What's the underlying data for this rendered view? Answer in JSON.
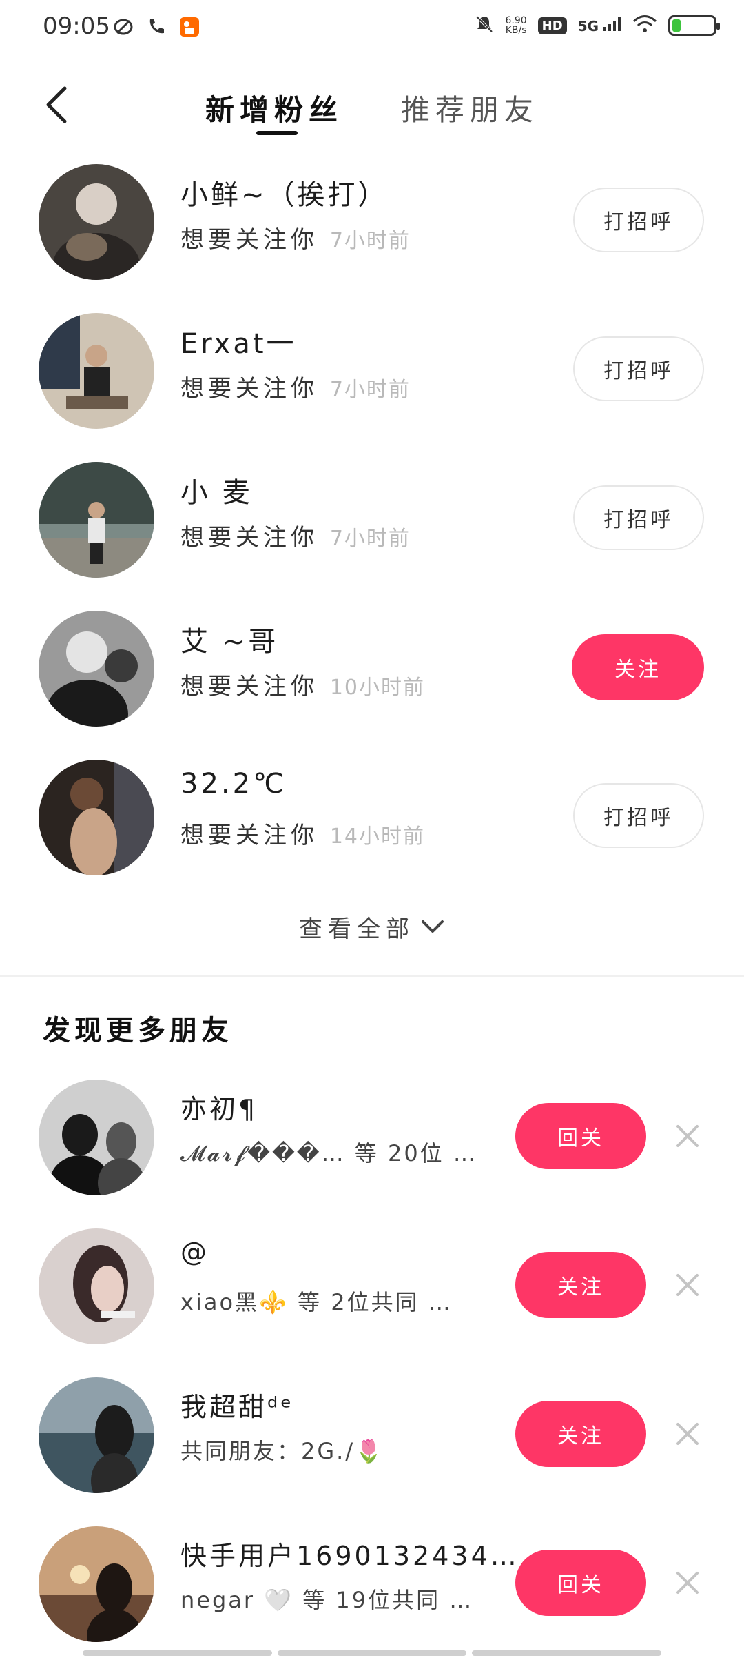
{
  "status_bar": {
    "time": "09:05",
    "net_speed": "6.90",
    "net_unit": "KB/s",
    "hd": "HD",
    "network": "5G",
    "battery_level": 0.12,
    "icons_left": [
      "leaf-icon",
      "call-missed-icon",
      "kuaishou-app-icon"
    ],
    "icons_right": [
      "mute-icon",
      "signal-icon",
      "wifi-icon",
      "battery-icon"
    ]
  },
  "header": {
    "tabs": [
      {
        "label": "新增粉丝",
        "active": true
      },
      {
        "label": "推荐朋友",
        "active": false
      }
    ]
  },
  "followers": [
    {
      "name": "小鲜~（挨打）",
      "action": "想要关注你",
      "time": "7小时前",
      "button": "打招呼",
      "button_style": "outline",
      "avatar": "#3b3b3b"
    },
    {
      "name": "Erxat一",
      "action": "想要关注你",
      "time": "7小时前",
      "button": "打招呼",
      "button_style": "outline",
      "avatar": "#6a6f75"
    },
    {
      "name": "小 麦",
      "action": "想要关注你",
      "time": "7小时前",
      "button": "打招呼",
      "button_style": "outline",
      "avatar": "#5e6b62"
    },
    {
      "name": "艾 ~哥",
      "action": "想要关注你",
      "time": "10小时前",
      "button": "关注",
      "button_style": "pink",
      "avatar": "#444444"
    },
    {
      "name": "32.2℃",
      "action": "想要关注你",
      "time": "14小时前",
      "button": "打招呼",
      "button_style": "outline",
      "avatar": "#2d2622"
    }
  ],
  "view_all": "查看全部",
  "discover": {
    "title": "发现更多朋友",
    "items": [
      {
        "name": "亦初¶",
        "sub": "𝓜𝓪𝓻𝓯���… 等 20位 …",
        "button": "回关",
        "avatar": "#8a8a8a"
      },
      {
        "name": "@",
        "sub": "xiao黑⚜️ 等 2位共同 …",
        "button": "关注",
        "avatar": "#a39a98"
      },
      {
        "name": "我超甜ᵈᵉ",
        "sub": "共同朋友：2G./🌷",
        "button": "关注",
        "avatar": "#5a6670"
      },
      {
        "name": "快手用户1690132434…",
        "sub": "negar 🤍 等 19位共同 …",
        "button": "回关",
        "avatar": "#8a6a55"
      }
    ]
  },
  "colors": {
    "accent": "#fe3666",
    "muted": "#b9b9b9"
  }
}
